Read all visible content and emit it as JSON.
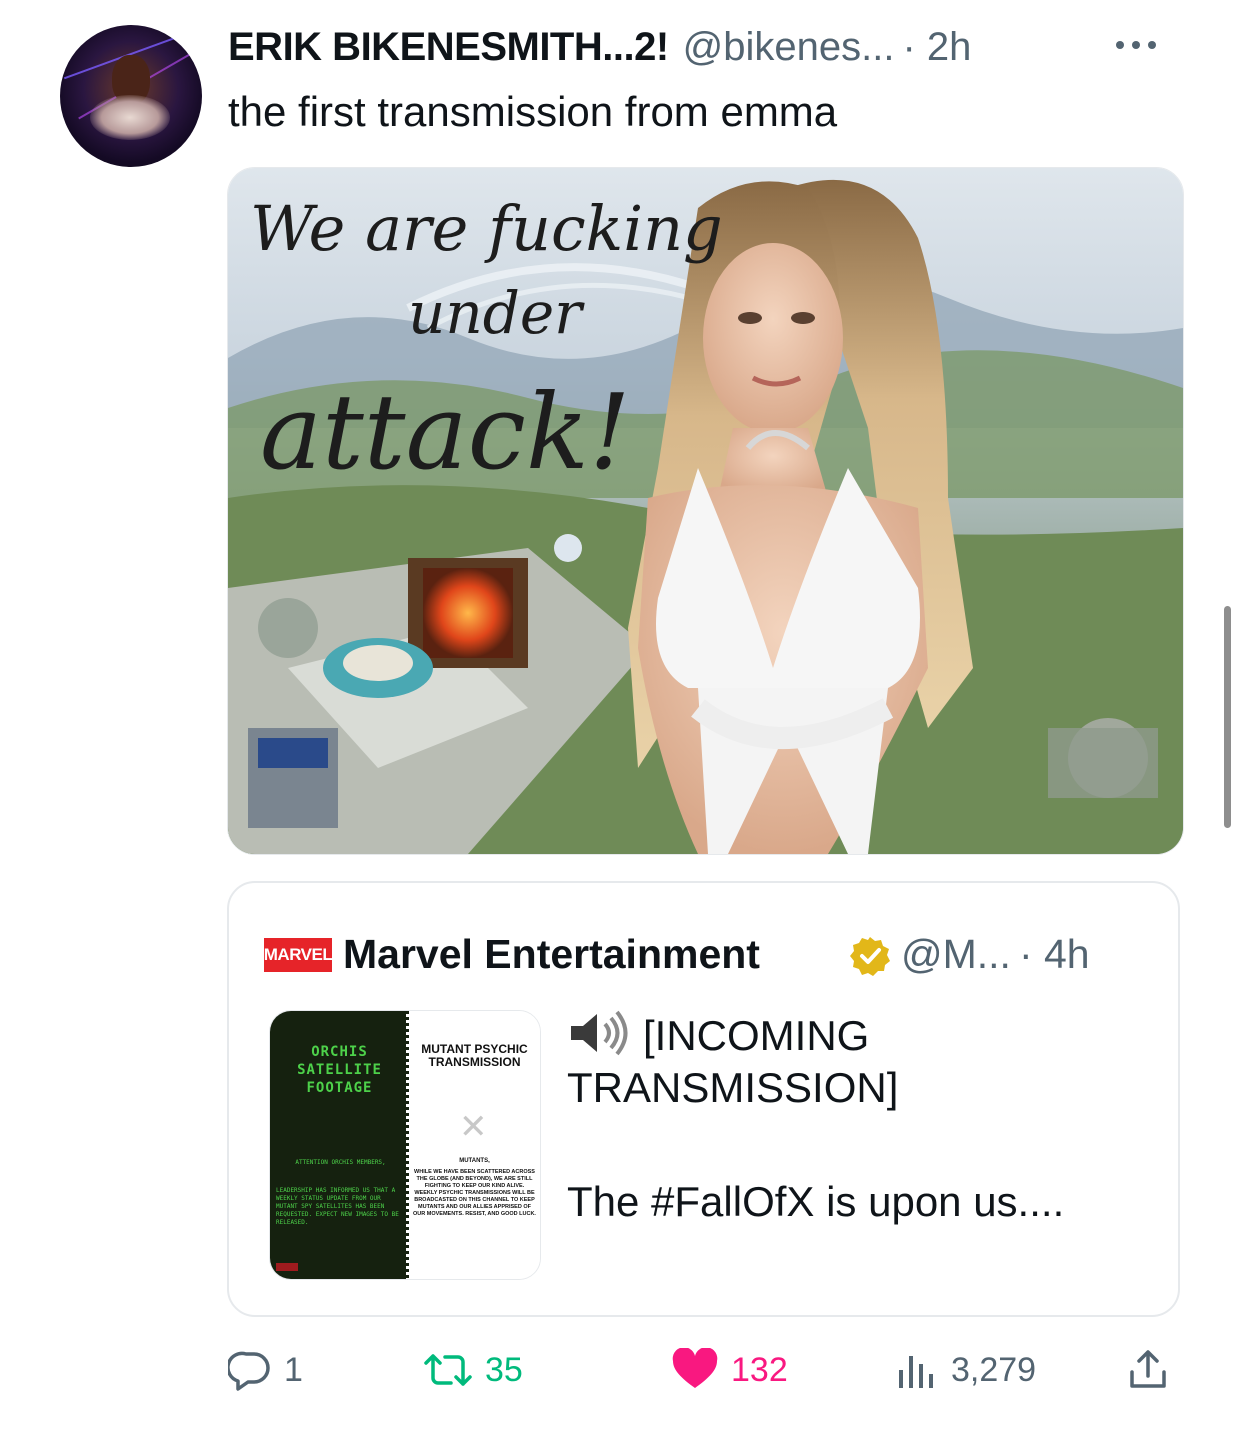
{
  "tweet": {
    "display_name": "ERIK BIKENESMITH...2!",
    "handle": "@bikenes...",
    "time": "· 2h",
    "text": "the first transmission from emma",
    "media": {
      "overlay_line1": "We are fucking",
      "overlay_line2": "under",
      "overlay_line3": "attack!"
    }
  },
  "quote": {
    "logo_text": "MARVEL",
    "display_name": "Marvel Entertainment",
    "handle": "@M...",
    "time": "· 4h",
    "line1": "[INCOMING",
    "line2": "TRANSMISSION]",
    "line3": "The #FallOfX is upon us....",
    "media": {
      "left_title": "ORCHIS SATELLITE FOOTAGE",
      "left_sub": "ATTENTION ORCHIS MEMBERS,",
      "left_body": "LEADERSHIP HAS INFORMED US THAT A WEEKLY STATUS UPDATE FROM OUR MUTANT SPY SATELLITES HAS BEEN REQUESTED. EXPECT NEW IMAGES TO BE RELEASED.",
      "right_title": "MUTANT PSYCHIC TRANSMISSION",
      "right_sub": "MUTANTS,",
      "right_body": "WHILE WE HAVE BEEN SCATTERED ACROSS THE GLOBE (AND BEYOND), WE ARE STILL FIGHTING TO KEEP OUR KIND ALIVE. WEEKLY PSYCHIC TRANSMISSIONS WILL BE BROADCASTED ON THIS CHANNEL TO KEEP MUTANTS AND OUR ALLIES APPRISED OF OUR MOVEMENTS. RESIST, AND GOOD LUCK."
    }
  },
  "actions": {
    "replies": "1",
    "retweets": "35",
    "likes": "132",
    "views": "3,279"
  },
  "colors": {
    "text": "#0f1419",
    "secondary": "#536471",
    "retweet": "#00ba7c",
    "like": "#f91880",
    "verified_gold": "#e2b719",
    "marvel_red": "#e62429"
  }
}
